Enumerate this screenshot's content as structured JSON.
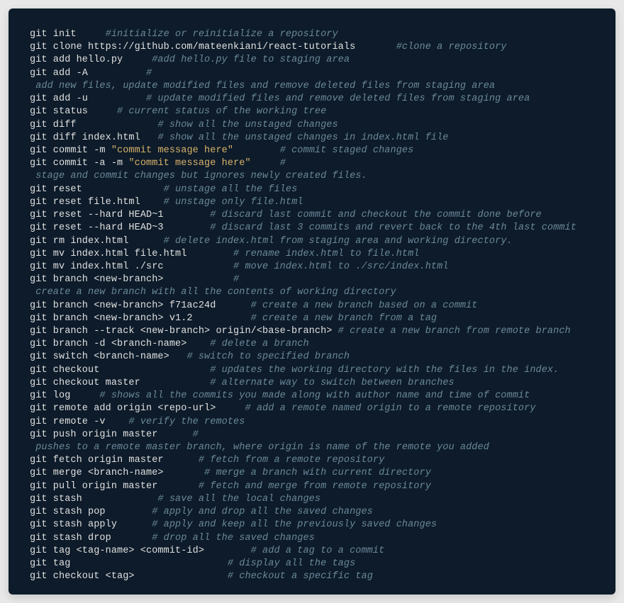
{
  "lines": [
    {
      "segments": [
        {
          "cls": "cmd",
          "text": "git init     "
        },
        {
          "cls": "com",
          "text": "#initialize or reinitialize a repository"
        }
      ]
    },
    {
      "segments": [
        {
          "cls": "cmd",
          "text": "git clone https://github.com/mateenkiani/react-tutorials       "
        },
        {
          "cls": "com",
          "text": "#clone a repository"
        }
      ]
    },
    {
      "segments": [
        {
          "cls": "cmd",
          "text": "git add hello.py     "
        },
        {
          "cls": "com",
          "text": "#add hello.py file to staging area"
        }
      ]
    },
    {
      "segments": [
        {
          "cls": "cmd",
          "text": "git add -A          "
        },
        {
          "cls": "com",
          "text": "#"
        }
      ]
    },
    {
      "segments": [
        {
          "cls": "com",
          "text": " add new files, update modified files and remove deleted files from staging area"
        }
      ]
    },
    {
      "segments": [
        {
          "cls": "cmd",
          "text": "git add -u          "
        },
        {
          "cls": "com",
          "text": "# update modified files and remove deleted files from staging area"
        }
      ]
    },
    {
      "segments": [
        {
          "cls": "cmd",
          "text": "git status     "
        },
        {
          "cls": "com",
          "text": "# current status of the working tree"
        }
      ]
    },
    {
      "segments": [
        {
          "cls": "cmd",
          "text": "git diff              "
        },
        {
          "cls": "com",
          "text": "# show all the unstaged changes"
        }
      ]
    },
    {
      "segments": [
        {
          "cls": "cmd",
          "text": "git diff index.html   "
        },
        {
          "cls": "com",
          "text": "# show all the unstaged changes in index.html file"
        }
      ]
    },
    {
      "segments": [
        {
          "cls": "cmd",
          "text": "git commit -m "
        },
        {
          "cls": "str",
          "text": "\"commit message here\""
        },
        {
          "cls": "cmd",
          "text": "        "
        },
        {
          "cls": "com",
          "text": "# commit staged changes"
        }
      ]
    },
    {
      "segments": [
        {
          "cls": "cmd",
          "text": "git commit -a -m "
        },
        {
          "cls": "str",
          "text": "\"commit message here\""
        },
        {
          "cls": "cmd",
          "text": "     "
        },
        {
          "cls": "com",
          "text": "#"
        }
      ]
    },
    {
      "segments": [
        {
          "cls": "com",
          "text": " stage and commit changes but ignores newly created files."
        }
      ]
    },
    {
      "segments": [
        {
          "cls": "cmd",
          "text": "git reset              "
        },
        {
          "cls": "com",
          "text": "# unstage all the files"
        }
      ]
    },
    {
      "segments": [
        {
          "cls": "cmd",
          "text": "git reset file.html    "
        },
        {
          "cls": "com",
          "text": "# unstage only file.html"
        }
      ]
    },
    {
      "segments": [
        {
          "cls": "cmd",
          "text": "git reset --hard HEAD~1        "
        },
        {
          "cls": "com",
          "text": "# discard last commit and checkout the commit done before"
        }
      ]
    },
    {
      "segments": [
        {
          "cls": "cmd",
          "text": "git reset --hard HEAD~3        "
        },
        {
          "cls": "com",
          "text": "# discard last 3 commits and revert back to the 4th last commit"
        }
      ]
    },
    {
      "segments": [
        {
          "cls": "cmd",
          "text": "git rm index.html      "
        },
        {
          "cls": "com",
          "text": "# delete index.html from staging area and working directory."
        }
      ]
    },
    {
      "segments": [
        {
          "cls": "cmd",
          "text": "git mv index.html file.html        "
        },
        {
          "cls": "com",
          "text": "# rename index.html to file.html"
        }
      ]
    },
    {
      "segments": [
        {
          "cls": "cmd",
          "text": "git mv index.html ./src            "
        },
        {
          "cls": "com",
          "text": "# move index.html to ./src/index.html"
        }
      ]
    },
    {
      "segments": [
        {
          "cls": "cmd",
          "text": "git branch <new-branch>            "
        },
        {
          "cls": "com",
          "text": "#"
        }
      ]
    },
    {
      "segments": [
        {
          "cls": "com",
          "text": " create a new branch with all the contents of working directory"
        }
      ]
    },
    {
      "segments": [
        {
          "cls": "cmd",
          "text": "git branch <new-branch> f71ac24d      "
        },
        {
          "cls": "com",
          "text": "# create a new branch based on a commit"
        }
      ]
    },
    {
      "segments": [
        {
          "cls": "cmd",
          "text": "git branch <new-branch> v1.2          "
        },
        {
          "cls": "com",
          "text": "# create a new branch from a tag"
        }
      ]
    },
    {
      "segments": [
        {
          "cls": "cmd",
          "text": "git branch --track <new-branch> origin/<base-branch> "
        },
        {
          "cls": "com",
          "text": "# create a new branch from remote branch"
        }
      ]
    },
    {
      "segments": [
        {
          "cls": "cmd",
          "text": "git branch -d <branch-name>    "
        },
        {
          "cls": "com",
          "text": "# delete a branch"
        }
      ]
    },
    {
      "segments": [
        {
          "cls": "cmd",
          "text": "git switch <branch-name>   "
        },
        {
          "cls": "com",
          "text": "# switch to specified branch"
        }
      ]
    },
    {
      "segments": [
        {
          "cls": "cmd",
          "text": "git checkout                   "
        },
        {
          "cls": "com",
          "text": "# updates the working directory with the files in the index."
        }
      ]
    },
    {
      "segments": [
        {
          "cls": "cmd",
          "text": "git checkout master            "
        },
        {
          "cls": "com",
          "text": "# alternate way to switch between branches"
        }
      ]
    },
    {
      "segments": [
        {
          "cls": "cmd",
          "text": "git log     "
        },
        {
          "cls": "com",
          "text": "# shows all the commits you made along with author name and time of commit"
        }
      ]
    },
    {
      "segments": [
        {
          "cls": "cmd",
          "text": "git remote add origin <repo-url>     "
        },
        {
          "cls": "com",
          "text": "# add a remote named origin to a remote repository"
        }
      ]
    },
    {
      "segments": [
        {
          "cls": "cmd",
          "text": "git remote -v    "
        },
        {
          "cls": "com",
          "text": "# verify the remotes"
        }
      ]
    },
    {
      "segments": [
        {
          "cls": "cmd",
          "text": "git push origin master      "
        },
        {
          "cls": "com",
          "text": "#"
        }
      ]
    },
    {
      "segments": [
        {
          "cls": "com",
          "text": " pushes to a remote master branch, where origin is name of the remote you added"
        }
      ]
    },
    {
      "segments": [
        {
          "cls": "cmd",
          "text": "git fetch origin master      "
        },
        {
          "cls": "com",
          "text": "# fetch from a remote repository"
        }
      ]
    },
    {
      "segments": [
        {
          "cls": "cmd",
          "text": "git merge <branch-name>       "
        },
        {
          "cls": "com",
          "text": "# merge a branch with current directory"
        }
      ]
    },
    {
      "segments": [
        {
          "cls": "cmd",
          "text": "git pull origin master       "
        },
        {
          "cls": "com",
          "text": "# fetch and merge from remote repository"
        }
      ]
    },
    {
      "segments": [
        {
          "cls": "cmd",
          "text": "git stash             "
        },
        {
          "cls": "com",
          "text": "# save all the local changes"
        }
      ]
    },
    {
      "segments": [
        {
          "cls": "cmd",
          "text": "git stash pop        "
        },
        {
          "cls": "com",
          "text": "# apply and drop all the saved changes"
        }
      ]
    },
    {
      "segments": [
        {
          "cls": "cmd",
          "text": "git stash apply      "
        },
        {
          "cls": "com",
          "text": "# apply and keep all the previously saved changes"
        }
      ]
    },
    {
      "segments": [
        {
          "cls": "cmd",
          "text": "git stash drop       "
        },
        {
          "cls": "com",
          "text": "# drop all the saved changes"
        }
      ]
    },
    {
      "segments": [
        {
          "cls": "cmd",
          "text": "git tag <tag-name> <commit-id>        "
        },
        {
          "cls": "com",
          "text": "# add a tag to a commit"
        }
      ]
    },
    {
      "segments": [
        {
          "cls": "cmd",
          "text": "git tag                           "
        },
        {
          "cls": "com",
          "text": "# display all the tags"
        }
      ]
    },
    {
      "segments": [
        {
          "cls": "cmd",
          "text": "git checkout <tag>                "
        },
        {
          "cls": "com",
          "text": "# checkout a specific tag"
        }
      ]
    }
  ]
}
